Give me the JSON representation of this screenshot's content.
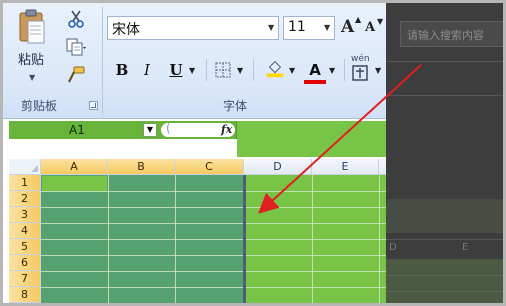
{
  "clipboard": {
    "paste_label": "粘贴",
    "group_label": "剪贴板"
  },
  "font": {
    "font_name": "宋体",
    "font_size": "11",
    "group_label": "字体",
    "bold": "B",
    "italic": "I",
    "underline": "U",
    "grow": "A",
    "shrink": "A",
    "font_color_letter": "A",
    "phonetic": "wén"
  },
  "formula_bar": {
    "name_box": "A1",
    "fx": "fx"
  },
  "sheet": {
    "columns": [
      "A",
      "B",
      "C",
      "D",
      "E"
    ],
    "rows": [
      "1",
      "2",
      "3",
      "4",
      "5",
      "6",
      "7",
      "8"
    ]
  },
  "overlay": {
    "search_placeholder": "请输入搜索内容",
    "col_d": "D",
    "col_e": "E"
  },
  "colors": {
    "sheet_green": "#78c447",
    "selection_green": "#55a270",
    "arrow_red": "#e02020",
    "highlight_yellow": "#ffd900",
    "font_red": "#e00000"
  }
}
